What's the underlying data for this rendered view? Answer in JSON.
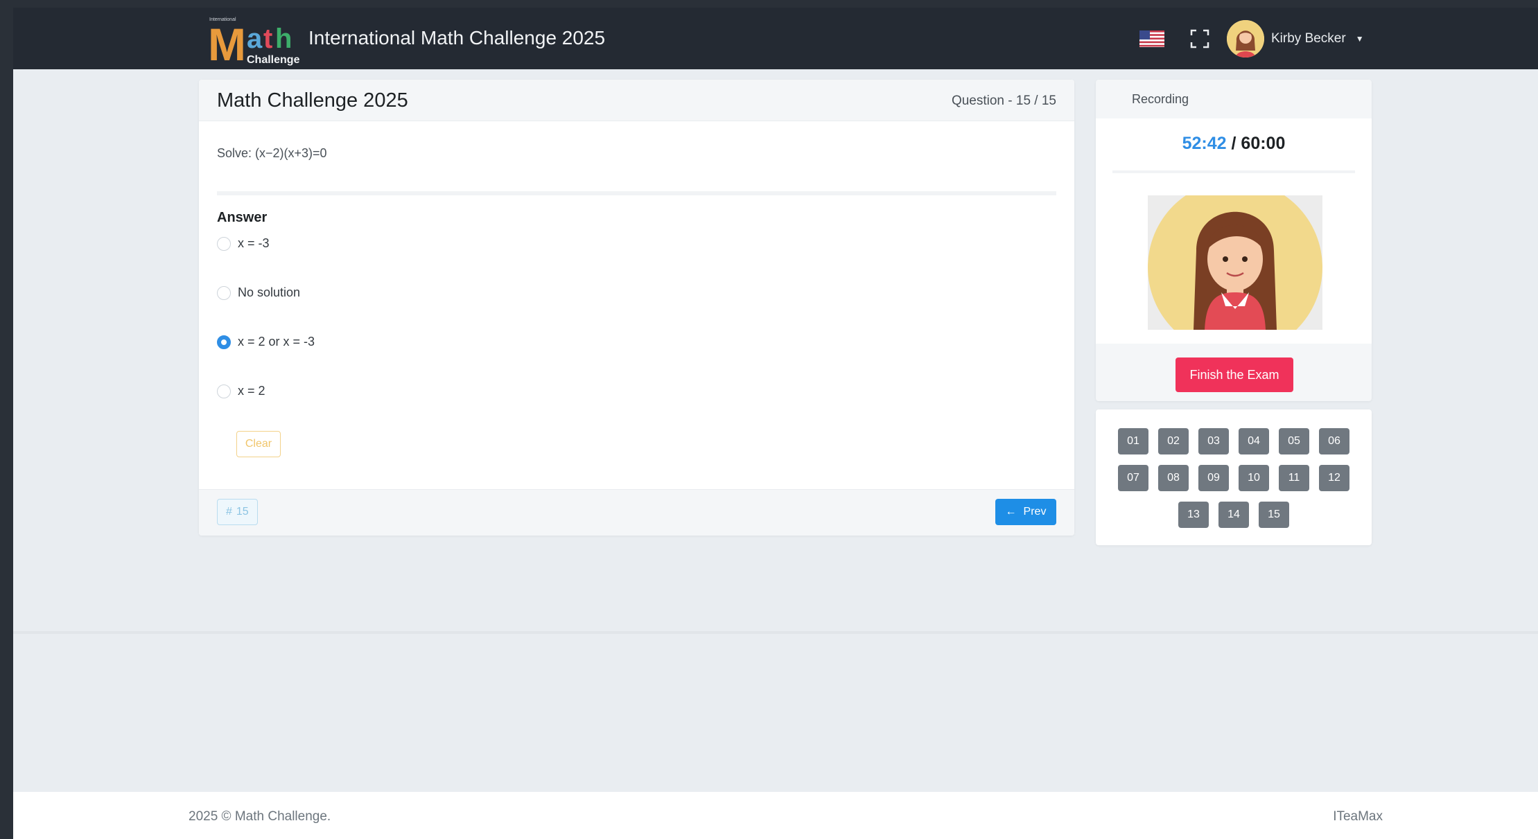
{
  "header": {
    "logo_top": "International",
    "logo_main": "Math",
    "logo_sub": "Challenge",
    "title": "International Math Challenge 2025",
    "flag_icon": "us-flag-icon",
    "fullscreen_icon": "fullscreen-icon",
    "user_name": "Kirby Becker"
  },
  "question_card": {
    "title": "Math Challenge 2025",
    "counter": "Question - 15 / 15",
    "question": "Solve: (x−2)(x+3)=0",
    "answer_label": "Answer",
    "options": [
      {
        "label": "x = -3",
        "selected": false
      },
      {
        "label": "No solution",
        "selected": false
      },
      {
        "label": "x = 2 or x = -3",
        "selected": true
      },
      {
        "label": "x = 2",
        "selected": false
      }
    ],
    "clear_label": "Clear",
    "number_badge": "15",
    "prev_label": "Prev"
  },
  "recording": {
    "label": "Recording",
    "elapsed": "52:42",
    "total": "/ 60:00",
    "finish_label": "Finish the Exam"
  },
  "navigator": {
    "questions": [
      "01",
      "02",
      "03",
      "04",
      "05",
      "06",
      "07",
      "08",
      "09",
      "10",
      "11",
      "12",
      "13",
      "14",
      "15"
    ]
  },
  "footer": {
    "copyright": "2025 © Math Challenge.",
    "credit": "ITeaMax"
  },
  "colors": {
    "topbar": "#242a33",
    "accent_blue": "#1e8ee6",
    "finish_red": "#f0325a",
    "nav_button": "#707880",
    "page_bg": "#e9edf1"
  }
}
